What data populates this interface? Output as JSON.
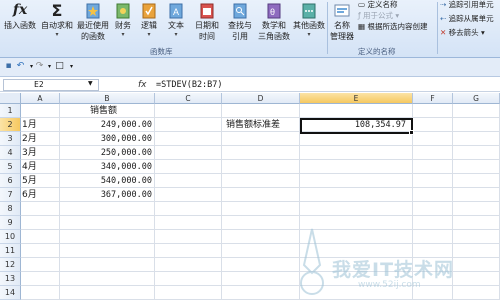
{
  "ribbon": {
    "insert_function": "插入函数",
    "autosum": "自动求和",
    "recent_line1": "最近使用",
    "recent_line2": "的函数",
    "financial": "财务",
    "logical": "逻辑",
    "text": "文本",
    "datetime_line1": "日期和",
    "datetime_line2": "时间",
    "lookup_line1": "查找与",
    "lookup_line2": "引用",
    "math_line1": "数学和",
    "math_line2": "三角函数",
    "other": "其他函数",
    "name_manager_line1": "名称",
    "name_manager_line2": "管理器",
    "define_name": "定义名称",
    "use_in_formula": "用于公式",
    "create_from_selection": "根据所选内容创建",
    "trace_precedents": "追踪引用单元",
    "trace_dependents": "追踪从属单元",
    "remove_arrows": "移去箭头",
    "group_function_library": "函数库",
    "group_defined_names": "定义的名称"
  },
  "formula_bar": {
    "name_box": "E2",
    "fx": "fx",
    "formula": "=STDEV(B2:B7)"
  },
  "grid": {
    "columns": [
      "A",
      "B",
      "C",
      "D",
      "E",
      "F",
      "G"
    ],
    "rows": [
      "1",
      "2",
      "3",
      "4",
      "5",
      "6",
      "7",
      "8",
      "9",
      "10",
      "11",
      "12",
      "13",
      "14"
    ],
    "header_b1": "销售额",
    "months": [
      "1月",
      "2月",
      "3月",
      "4月",
      "5月",
      "6月"
    ],
    "sales": [
      "249,000.00",
      "300,000.00",
      "250,000.00",
      "340,000.00",
      "540,000.00",
      "367,000.00"
    ],
    "d2_label": "销售额标准差",
    "e2_value": "108,354.97"
  },
  "watermark": {
    "text": "我爱IT技术网",
    "url": "www.52ij.com"
  }
}
